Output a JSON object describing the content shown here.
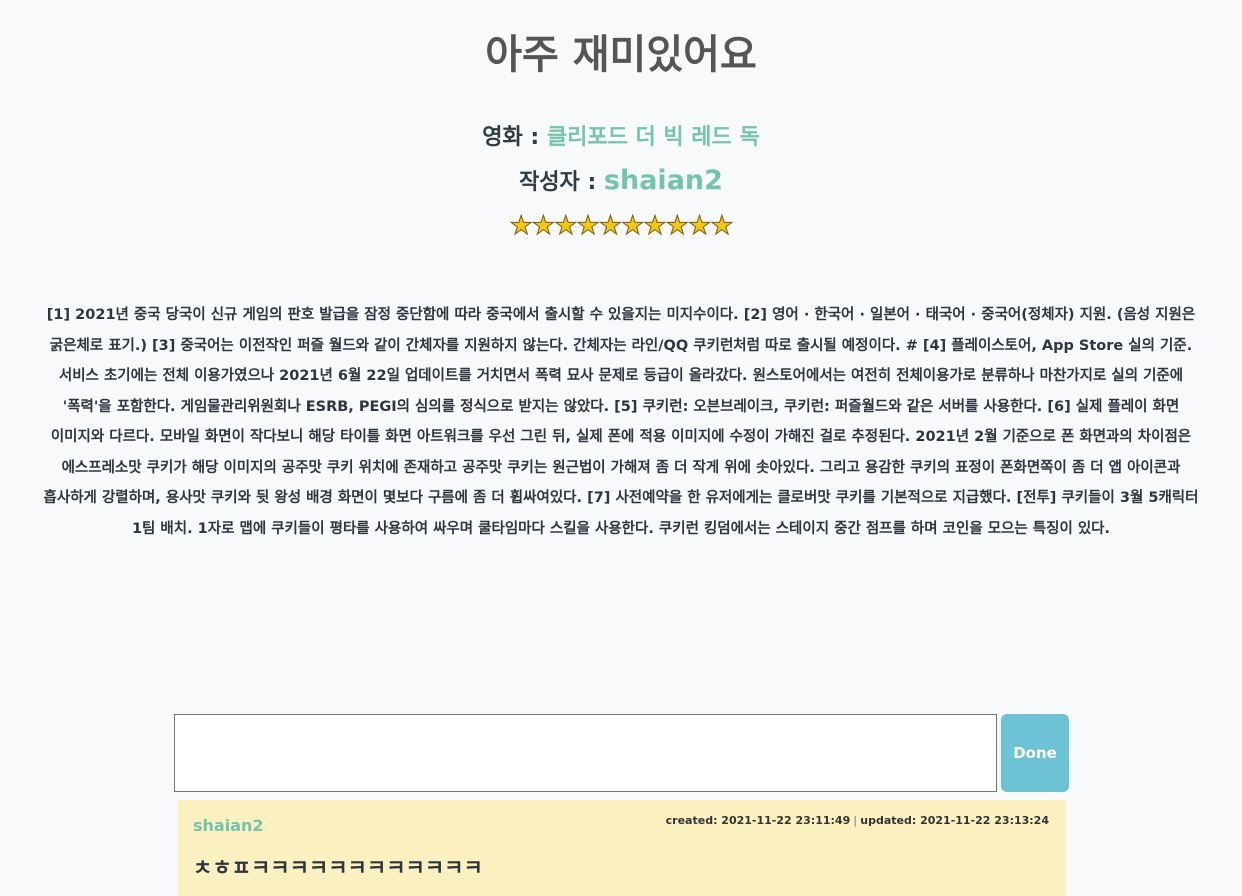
{
  "review": {
    "title": "아주 재미있어요",
    "movie_label": "영화 :",
    "movie_value": "클리포드 더 빅 레드 독",
    "author_label": "작성자 :",
    "author_value": "shaian2",
    "rating_display": "★★★★★★★★★★",
    "rating": 10,
    "rating_max": 10,
    "body": "[1] 2021년 중국 당국이 신규 게임의 판호 발급을 잠정 중단함에 따라 중국에서 출시할 수 있을지는 미지수이다. [2] 영어 · 한국어 · 일본어 · 태국어 · 중국어(정체자) 지원. (음성 지원은 굵은체로 표기.) [3] 중국어는 이전작인 퍼즐 월드와 같이 간체자를 지원하지 않는다. 간체자는 라인/QQ 쿠키런처럼 따로 출시될 예정이다. # [4] 플레이스토어, App Store 실의 기준. 서비스 초기에는 전체 이용가였으나 2021년 6월 22일 업데이트를 거치면서 폭력 묘사 문제로 등급이 올라갔다. 원스토어에서는 여전히 전체이용가로 분류하나 마찬가지로 실의 기준에 '폭력'을 포함한다. 게임물관리위원회나 ESRB, PEGI의 심의를 정식으로 받지는 않았다. [5] 쿠키런: 오븐브레이크, 쿠키런: 퍼즐월드와 같은 서버를 사용한다. [6] 실제 플레이 화면 이미지와 다르다. 모바일 화면이 작다보니 해당 타이틀 화면 아트워크를 우선 그린 뒤, 실제 폰에 적용 이미지에 수정이 가해진 걸로 추정된다. 2021년 2월 기준으로 폰 화면과의 차이점은 에스프레소맛 쿠키가 해당 이미지의 공주맛 쿠키 위치에 존재하고 공주맛 쿠키는 원근법이 가해져 좀 더 작게 위에 솟아있다. 그리고 용감한 쿠키의 표정이 폰화면쪽이 좀 더 앱 아이콘과 흡사하게 강렬하며, 용사맛 쿠키와 뒷 왕성 배경 화면이 몇보다 구름에 좀 더 휩싸여있다. [7] 사전예약을 한 유저에게는 클로버맛 쿠키를 기본적으로 지급했다. [전투] 쿠키들이 3월 5캐릭터 1팀 배치. 1자로 맵에 쿠키들이 평타를 사용하여 싸우며 쿨타임마다 스킬을 사용한다. 쿠키런 킹덤에서는 스테이지 중간 점프를 하며 코인을 모으는 특징이 있다."
  },
  "comment_form": {
    "input_value": "",
    "done_label": "Done"
  },
  "comments": [
    {
      "author": "shaian2",
      "created": "created: 2021-11-22 23:11:49",
      "separator": "|",
      "updated": "updated: 2021-11-22 23:13:24",
      "body": "ㅊㅎㅍㅋㅋㅋㅋㅋㅋㅋㅋㅋㅋㅋㅋ"
    }
  ],
  "colors": {
    "accent": "#72c4ac",
    "done_button": "#6ec2d6",
    "comment_bg": "#fbf0c0",
    "star": "#f5c518"
  }
}
